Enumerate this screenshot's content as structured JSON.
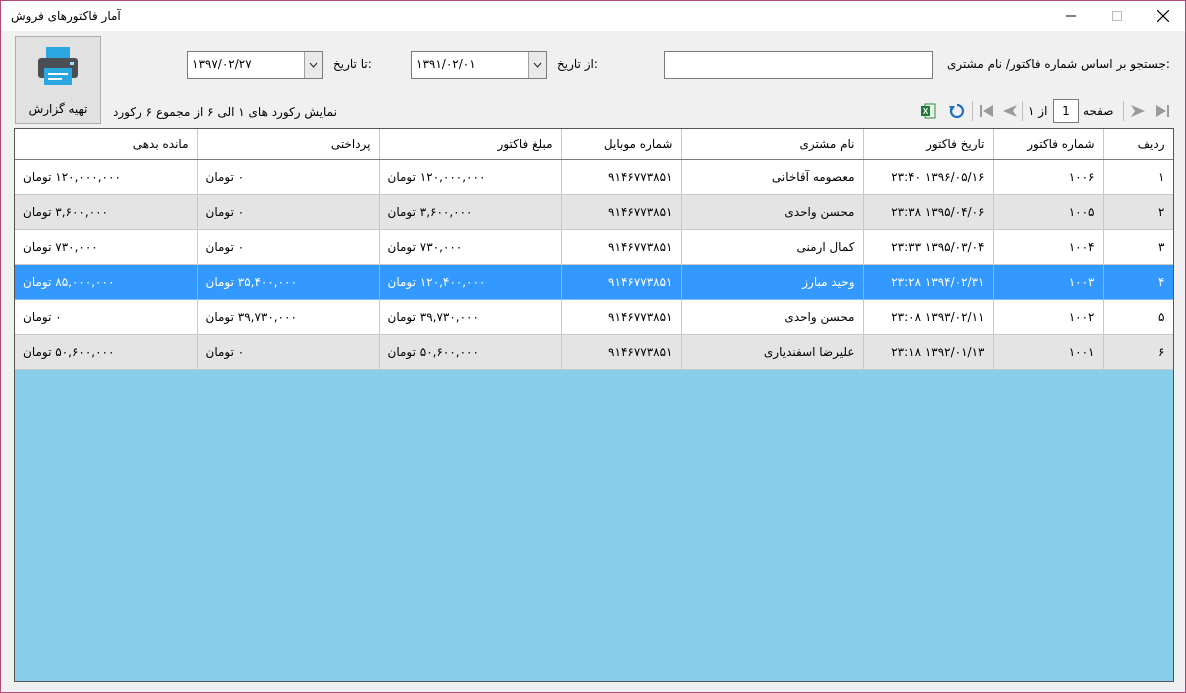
{
  "window": {
    "title": "آمار فاکتورهای فروش"
  },
  "toolbar": {
    "report_label": "تهیه گزارش",
    "search_label": "جستجو بر اساس شماره فاکتور/ نام مشتری:",
    "search_value": "",
    "from_label": "از تاریخ:",
    "from_value": "۱۳۹۱/۰۲/۰۱",
    "to_label": "تا تاریخ:",
    "to_value": "۱۳۹۷/۰۲/۲۷"
  },
  "pager": {
    "page_label": "صفحه",
    "page_value": "1",
    "of_label": "از ۱",
    "summary": "نمایش رکورد های ۱ الی ۶ از مجموع ۶ رکورد"
  },
  "table": {
    "columns": [
      "ردیف",
      "شماره فاکتور",
      "تاریخ فاکتور",
      "نام مشتری",
      "شماره موبایل",
      "مبلغ فاکتور",
      "پرداختی",
      "مانده بدهی"
    ],
    "rows": [
      [
        "۱",
        "۱۰۰۶",
        "۱۳۹۶/۰۵/۱۶ ۲۳:۴۰",
        "معصومه آقاخانی",
        "۹۱۴۶۷۷۳۸۵۱",
        "۱۲۰,۰۰۰,۰۰۰ تومان",
        "۰ تومان",
        "۱۲۰,۰۰۰,۰۰۰ تومان"
      ],
      [
        "۲",
        "۱۰۰۵",
        "۱۳۹۵/۰۴/۰۶ ۲۳:۳۸",
        "محسن واحدی",
        "۹۱۴۶۷۷۳۸۵۱",
        "۳,۶۰۰,۰۰۰ تومان",
        "۰ تومان",
        "۳,۶۰۰,۰۰۰ تومان"
      ],
      [
        "۳",
        "۱۰۰۴",
        "۱۳۹۵/۰۳/۰۴ ۲۳:۳۳",
        "کمال ارمنی",
        "۹۱۴۶۷۷۳۸۵۱",
        "۷۳۰,۰۰۰ تومان",
        "۰ تومان",
        "۷۳۰,۰۰۰ تومان"
      ],
      [
        "۴",
        "۱۰۰۳",
        "۱۳۹۴/۰۲/۳۱ ۲۳:۲۸",
        "وحید مبارز",
        "۹۱۴۶۷۷۳۸۵۱",
        "۱۲۰,۴۰۰,۰۰۰ تومان",
        "۳۵,۴۰۰,۰۰۰ تومان",
        "۸۵,۰۰۰,۰۰۰ تومان"
      ],
      [
        "۵",
        "۱۰۰۲",
        "۱۳۹۳/۰۲/۱۱ ۲۳:۰۸",
        "محسن واحدی",
        "۹۱۴۶۷۷۳۸۵۱",
        "۳۹,۷۳۰,۰۰۰ تومان",
        "۳۹,۷۳۰,۰۰۰ تومان",
        "۰ تومان"
      ],
      [
        "۶",
        "۱۰۰۱",
        "۱۳۹۲/۰۱/۱۳ ۲۳:۱۸",
        "علیرضا اسفندیاری",
        "۹۱۴۶۷۷۳۸۵۱",
        "۵۰,۶۰۰,۰۰۰ تومان",
        "۰ تومان",
        "۵۰,۶۰۰,۰۰۰ تومان"
      ]
    ],
    "selected_row": 3
  }
}
